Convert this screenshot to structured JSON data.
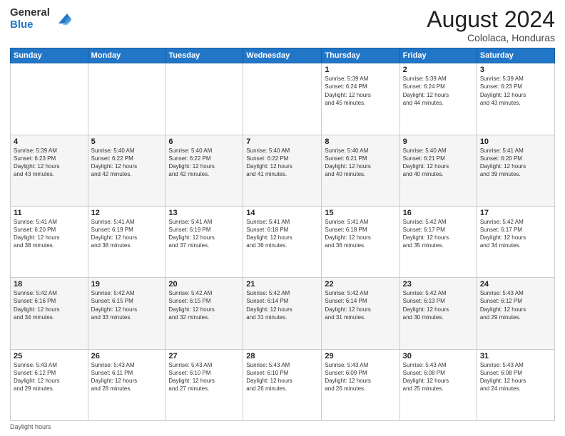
{
  "header": {
    "logo_general": "General",
    "logo_blue": "Blue",
    "month_year": "August 2024",
    "location": "Cololaca, Honduras"
  },
  "days_of_week": [
    "Sunday",
    "Monday",
    "Tuesday",
    "Wednesday",
    "Thursday",
    "Friday",
    "Saturday"
  ],
  "footer": {
    "daylight_label": "Daylight hours"
  },
  "weeks": [
    [
      {
        "num": "",
        "info": ""
      },
      {
        "num": "",
        "info": ""
      },
      {
        "num": "",
        "info": ""
      },
      {
        "num": "",
        "info": ""
      },
      {
        "num": "1",
        "info": "Sunrise: 5:39 AM\nSunset: 6:24 PM\nDaylight: 12 hours\nand 45 minutes."
      },
      {
        "num": "2",
        "info": "Sunrise: 5:39 AM\nSunset: 6:24 PM\nDaylight: 12 hours\nand 44 minutes."
      },
      {
        "num": "3",
        "info": "Sunrise: 5:39 AM\nSunset: 6:23 PM\nDaylight: 12 hours\nand 43 minutes."
      }
    ],
    [
      {
        "num": "4",
        "info": "Sunrise: 5:39 AM\nSunset: 6:23 PM\nDaylight: 12 hours\nand 43 minutes."
      },
      {
        "num": "5",
        "info": "Sunrise: 5:40 AM\nSunset: 6:22 PM\nDaylight: 12 hours\nand 42 minutes."
      },
      {
        "num": "6",
        "info": "Sunrise: 5:40 AM\nSunset: 6:22 PM\nDaylight: 12 hours\nand 42 minutes."
      },
      {
        "num": "7",
        "info": "Sunrise: 5:40 AM\nSunset: 6:22 PM\nDaylight: 12 hours\nand 41 minutes."
      },
      {
        "num": "8",
        "info": "Sunrise: 5:40 AM\nSunset: 6:21 PM\nDaylight: 12 hours\nand 40 minutes."
      },
      {
        "num": "9",
        "info": "Sunrise: 5:40 AM\nSunset: 6:21 PM\nDaylight: 12 hours\nand 40 minutes."
      },
      {
        "num": "10",
        "info": "Sunrise: 5:41 AM\nSunset: 6:20 PM\nDaylight: 12 hours\nand 39 minutes."
      }
    ],
    [
      {
        "num": "11",
        "info": "Sunrise: 5:41 AM\nSunset: 6:20 PM\nDaylight: 12 hours\nand 38 minutes."
      },
      {
        "num": "12",
        "info": "Sunrise: 5:41 AM\nSunset: 6:19 PM\nDaylight: 12 hours\nand 38 minutes."
      },
      {
        "num": "13",
        "info": "Sunrise: 5:41 AM\nSunset: 6:19 PM\nDaylight: 12 hours\nand 37 minutes."
      },
      {
        "num": "14",
        "info": "Sunrise: 5:41 AM\nSunset: 6:18 PM\nDaylight: 12 hours\nand 36 minutes."
      },
      {
        "num": "15",
        "info": "Sunrise: 5:41 AM\nSunset: 6:18 PM\nDaylight: 12 hours\nand 36 minutes."
      },
      {
        "num": "16",
        "info": "Sunrise: 5:42 AM\nSunset: 6:17 PM\nDaylight: 12 hours\nand 35 minutes."
      },
      {
        "num": "17",
        "info": "Sunrise: 5:42 AM\nSunset: 6:17 PM\nDaylight: 12 hours\nand 34 minutes."
      }
    ],
    [
      {
        "num": "18",
        "info": "Sunrise: 5:42 AM\nSunset: 6:16 PM\nDaylight: 12 hours\nand 34 minutes."
      },
      {
        "num": "19",
        "info": "Sunrise: 5:42 AM\nSunset: 6:15 PM\nDaylight: 12 hours\nand 33 minutes."
      },
      {
        "num": "20",
        "info": "Sunrise: 5:42 AM\nSunset: 6:15 PM\nDaylight: 12 hours\nand 32 minutes."
      },
      {
        "num": "21",
        "info": "Sunrise: 5:42 AM\nSunset: 6:14 PM\nDaylight: 12 hours\nand 31 minutes."
      },
      {
        "num": "22",
        "info": "Sunrise: 5:42 AM\nSunset: 6:14 PM\nDaylight: 12 hours\nand 31 minutes."
      },
      {
        "num": "23",
        "info": "Sunrise: 5:42 AM\nSunset: 6:13 PM\nDaylight: 12 hours\nand 30 minutes."
      },
      {
        "num": "24",
        "info": "Sunrise: 5:43 AM\nSunset: 6:12 PM\nDaylight: 12 hours\nand 29 minutes."
      }
    ],
    [
      {
        "num": "25",
        "info": "Sunrise: 5:43 AM\nSunset: 6:12 PM\nDaylight: 12 hours\nand 29 minutes."
      },
      {
        "num": "26",
        "info": "Sunrise: 5:43 AM\nSunset: 6:11 PM\nDaylight: 12 hours\nand 28 minutes."
      },
      {
        "num": "27",
        "info": "Sunrise: 5:43 AM\nSunset: 6:10 PM\nDaylight: 12 hours\nand 27 minutes."
      },
      {
        "num": "28",
        "info": "Sunrise: 5:43 AM\nSunset: 6:10 PM\nDaylight: 12 hours\nand 26 minutes."
      },
      {
        "num": "29",
        "info": "Sunrise: 5:43 AM\nSunset: 6:09 PM\nDaylight: 12 hours\nand 26 minutes."
      },
      {
        "num": "30",
        "info": "Sunrise: 5:43 AM\nSunset: 6:08 PM\nDaylight: 12 hours\nand 25 minutes."
      },
      {
        "num": "31",
        "info": "Sunrise: 5:43 AM\nSunset: 6:08 PM\nDaylight: 12 hours\nand 24 minutes."
      }
    ]
  ]
}
